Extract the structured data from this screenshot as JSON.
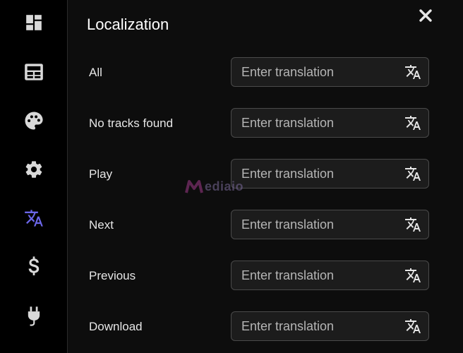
{
  "sidebar": {
    "items": [
      {
        "name": "dashboard-icon",
        "active": false
      },
      {
        "name": "table-icon",
        "active": false
      },
      {
        "name": "palette-icon",
        "active": false
      },
      {
        "name": "gear-icon",
        "active": false
      },
      {
        "name": "translate-icon",
        "active": true
      },
      {
        "name": "dollar-icon",
        "active": false
      },
      {
        "name": "plug-icon",
        "active": false
      }
    ]
  },
  "panel": {
    "title": "Localization",
    "close_icon": "close-icon"
  },
  "rows": [
    {
      "label": "All",
      "value": "",
      "placeholder": "Enter translation"
    },
    {
      "label": "No tracks found",
      "value": "",
      "placeholder": "Enter translation"
    },
    {
      "label": "Play",
      "value": "",
      "placeholder": "Enter translation"
    },
    {
      "label": "Next",
      "value": "",
      "placeholder": "Enter translation"
    },
    {
      "label": "Previous",
      "value": "",
      "placeholder": "Enter translation"
    },
    {
      "label": "Download",
      "value": "",
      "placeholder": "Enter translation"
    }
  ],
  "watermark": {
    "text": "ediaio"
  },
  "colors": {
    "icon": "#d9d9d9",
    "active_icon": "#6b66e8",
    "text": "#e6e6e6",
    "field_border": "#4a4a4a",
    "background": "#0d0d0d"
  }
}
